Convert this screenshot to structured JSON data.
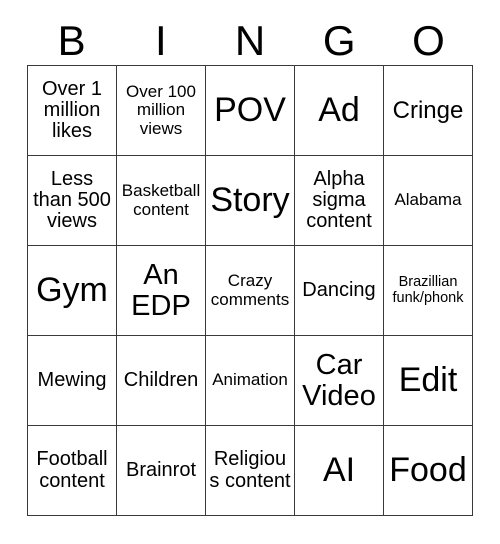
{
  "card": {
    "title": "BINGO",
    "header_letters": [
      "B",
      "I",
      "N",
      "G",
      "O"
    ],
    "columns": 5,
    "rows": 5,
    "border_color": "#3a3a3a",
    "background_color": "#ffffff",
    "text_color": "#000000",
    "grid": [
      [
        {
          "text": "Over 1 million likes",
          "size": "md"
        },
        {
          "text": "Over 100 million views",
          "size": "sm"
        },
        {
          "text": "POV",
          "size": "xxl"
        },
        {
          "text": "Ad",
          "size": "xxl"
        },
        {
          "text": "Cringe",
          "size": "lg"
        }
      ],
      [
        {
          "text": "Less than 500 views",
          "size": "md"
        },
        {
          "text": "Basketball content",
          "size": "sm"
        },
        {
          "text": "Story",
          "size": "xxl"
        },
        {
          "text": "Alpha sigma content",
          "size": "md"
        },
        {
          "text": "Alabama",
          "size": "sm"
        }
      ],
      [
        {
          "text": "Gym",
          "size": "xxl"
        },
        {
          "text": "An EDP",
          "size": "xl"
        },
        {
          "text": "Crazy comments",
          "size": "sm"
        },
        {
          "text": "Dancing",
          "size": "md"
        },
        {
          "text": "Brazillian funk/phonk",
          "size": "xs"
        }
      ],
      [
        {
          "text": "Mewing",
          "size": "md"
        },
        {
          "text": "Children",
          "size": "md"
        },
        {
          "text": "Animation",
          "size": "sm"
        },
        {
          "text": "Car Video",
          "size": "xl"
        },
        {
          "text": "Edit",
          "size": "xxl"
        }
      ],
      [
        {
          "text": "Football content",
          "size": "md"
        },
        {
          "text": "Brainrot",
          "size": "md"
        },
        {
          "text": "Religious content",
          "size": "md"
        },
        {
          "text": "AI",
          "size": "xxl"
        },
        {
          "text": "Food",
          "size": "xxl"
        }
      ]
    ]
  }
}
